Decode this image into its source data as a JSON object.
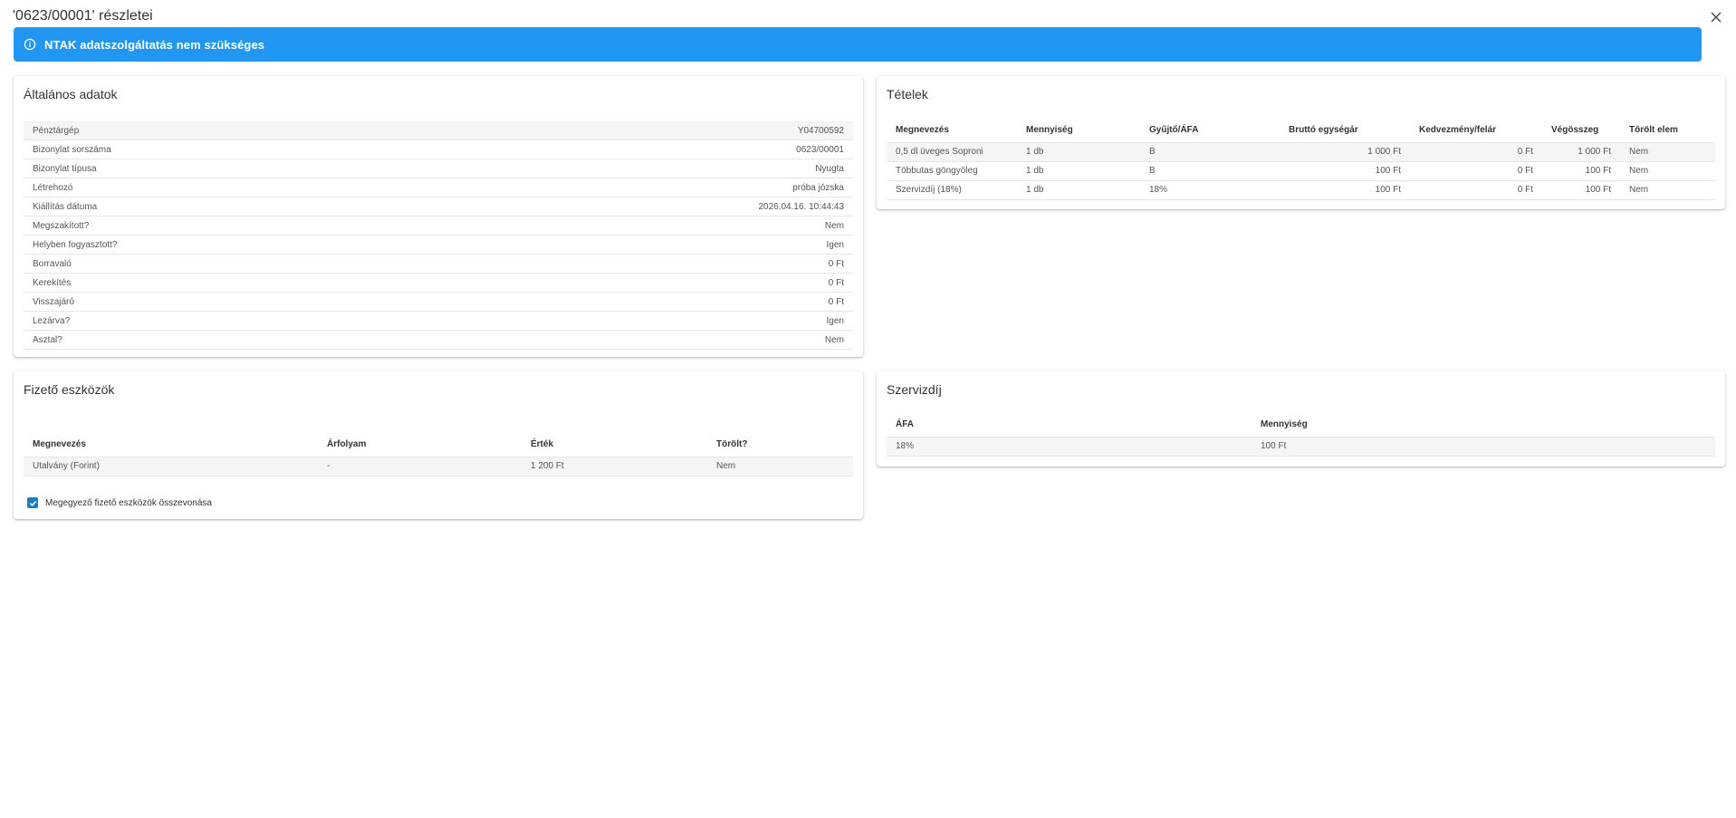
{
  "dialog": {
    "title": "'0623/00001' részletei"
  },
  "alert": {
    "text": "NTAK adatszolgáltatás nem szükséges",
    "color": "#2196f3"
  },
  "general": {
    "title": "Általános adatok",
    "rows": [
      {
        "label": "Pénztárgép",
        "value": "Y04700592"
      },
      {
        "label": "Bizonylat sorszáma",
        "value": "0623/00001"
      },
      {
        "label": "Bizonylat típusa",
        "value": "Nyugta"
      },
      {
        "label": "Létrehozó",
        "value": "próba józska"
      },
      {
        "label": "Kiállítás dátuma",
        "value": "2026.04.16. 10:44:43"
      },
      {
        "label": "Megszakított?",
        "value": "Nem"
      },
      {
        "label": "Helyben fogyasztott?",
        "value": "Igen"
      },
      {
        "label": "Borravaló",
        "value": "0 Ft"
      },
      {
        "label": "Kerekítés",
        "value": "0 Ft"
      },
      {
        "label": "Visszajáró",
        "value": "0 Ft"
      },
      {
        "label": "Lezárva?",
        "value": "Igen"
      },
      {
        "label": "Asztal?",
        "value": "Nem"
      }
    ]
  },
  "items": {
    "title": "Tételek",
    "headers": [
      "Megnevezés",
      "Mennyiség",
      "Gyűjtő/ÁFA",
      "Bruttó egységár",
      "Kedvezmény/felár",
      "Végösszeg",
      "Törölt elem"
    ],
    "rows": [
      [
        "0,5 dl üveges Soproni",
        "1 db",
        "B",
        "1 000 Ft",
        "0 Ft",
        "1 000 Ft",
        "Nem"
      ],
      [
        "Többutas göngyöleg",
        "1 db",
        "B",
        "100 Ft",
        "0 Ft",
        "100 Ft",
        "Nem"
      ],
      [
        "Szervizdíj (18%)",
        "1 db",
        "18%",
        "100 Ft",
        "0 Ft",
        "100 Ft",
        "Nem"
      ]
    ]
  },
  "payments": {
    "title": "Fizető eszközök",
    "headers": [
      "Megnevezés",
      "Árfolyam",
      "Érték",
      "Törölt?"
    ],
    "rows": [
      [
        "Utalvány (Forint)",
        "-",
        "1 200 Ft",
        "Nem"
      ]
    ],
    "merge_label": "Megegyező fizető eszközök összevonása",
    "merge_checked": true
  },
  "service": {
    "title": "Szervizdíj",
    "headers": [
      "ÁFA",
      "Mennyiség"
    ],
    "rows": [
      [
        "18%",
        "100 Ft"
      ]
    ]
  },
  "icons": {
    "alert": "info-circle-icon",
    "close": "close-icon",
    "checkbox": "check-icon"
  }
}
